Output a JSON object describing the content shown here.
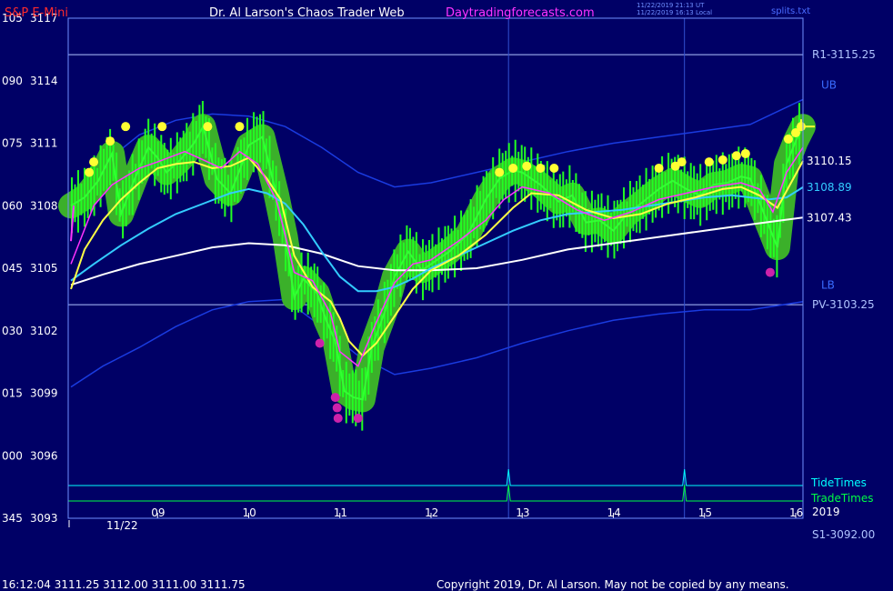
{
  "header": {
    "instrument": "S&P E-Mini",
    "site_title": "Dr. Al Larson's Chaos Trader Web",
    "site_url": "Daytradingforecasts.com",
    "stamp_ut": "11/22/2019 21:13 UT",
    "stamp_local": "11/22/2019 16:13 Local",
    "config_name": "splits.txt"
  },
  "footer": {
    "quote": "16:12:04  3111.25 3112.00 3111.00 3111.75",
    "copyright": "Copyright 2019, Dr. Al Larson. May not be copied by any means."
  },
  "chart_data": {
    "type": "line",
    "x_unit": "hour of day",
    "xlim": [
      8.02,
      16.08
    ],
    "ylim": [
      3093,
      3117
    ],
    "y_ticks": [
      {
        "value": 3117,
        "angle": "105"
      },
      {
        "value": 3114,
        "angle": "090"
      },
      {
        "value": 3111,
        "angle": "075"
      },
      {
        "value": 3108,
        "angle": "060"
      },
      {
        "value": 3105,
        "angle": "045"
      },
      {
        "value": 3102,
        "angle": "030"
      },
      {
        "value": 3099,
        "angle": "015"
      },
      {
        "value": 3096,
        "angle": "000"
      },
      {
        "value": 3093,
        "angle": "345"
      }
    ],
    "x_ticks": [
      "09",
      "10",
      "11",
      "12",
      "13",
      "14",
      "15",
      "16"
    ],
    "date_label": "11/22",
    "year_label": "2019",
    "pivot_levels": [
      {
        "label": "R1-3115.25",
        "value": 3115.25
      },
      {
        "label": "PV-3103.25",
        "value": 3103.25
      },
      {
        "label": "S1-3092.00",
        "value": 3092.0
      }
    ],
    "band_labels": {
      "upper": "UB",
      "lower": "LB"
    },
    "last_values": [
      {
        "label": "3110.15",
        "value": 3110.15,
        "color": "#ffffff"
      },
      {
        "label": "3108.89",
        "value": 3108.89,
        "color": "#33ccff"
      },
      {
        "label": "3107.43",
        "value": 3107.43,
        "color": "#ffffff"
      }
    ],
    "timing_lines": [
      {
        "name": "TideTimes",
        "color": "#00ffff",
        "spikes": [
          12.85,
          14.78
        ]
      },
      {
        "name": "TradeTimes",
        "color": "#00ff44",
        "spikes": [
          12.85,
          14.78
        ]
      }
    ],
    "vertical_markers": [
      12.85,
      14.78
    ],
    "series": [
      {
        "key": "price",
        "color": "#33ff33",
        "x": [
          8.05,
          8.2,
          8.35,
          8.5,
          8.6,
          8.75,
          8.9,
          9.0,
          9.1,
          9.25,
          9.4,
          9.5,
          9.65,
          9.8,
          9.9,
          10.0,
          10.15,
          10.3,
          10.4,
          10.5,
          10.6,
          10.75,
          10.85,
          10.95,
          11.05,
          11.15,
          11.25,
          11.35,
          11.5,
          11.6,
          11.75,
          11.9,
          12.0,
          12.2,
          12.4,
          12.6,
          12.75,
          12.9,
          13.0,
          13.2,
          13.4,
          13.55,
          13.7,
          13.85,
          14.0,
          14.15,
          14.3,
          14.5,
          14.65,
          14.8,
          14.95,
          15.1,
          15.25,
          15.4,
          15.5,
          15.6,
          15.7,
          15.8,
          15.9,
          16.0,
          16.08
        ],
        "values": [
          3108.0,
          3108.4,
          3109.2,
          3110.5,
          3107.6,
          3109.3,
          3110.8,
          3110.3,
          3109.6,
          3110.2,
          3111.0,
          3111.8,
          3109.3,
          3108.6,
          3109.7,
          3110.9,
          3111.3,
          3108.6,
          3106.5,
          3103.6,
          3104.5,
          3103.8,
          3102.5,
          3101.5,
          3099.1,
          3098.8,
          3098.7,
          3101.2,
          3103.0,
          3104.6,
          3105.8,
          3104.9,
          3105.2,
          3105.8,
          3106.6,
          3108.3,
          3109.3,
          3109.7,
          3109.6,
          3109.0,
          3108.2,
          3108.5,
          3107.2,
          3107.3,
          3106.8,
          3107.6,
          3108.1,
          3108.8,
          3109.2,
          3108.8,
          3108.5,
          3109.0,
          3109.1,
          3109.4,
          3109.3,
          3108.2,
          3107.1,
          3106.0,
          3110.0,
          3111.1,
          3111.8
        ]
      },
      {
        "key": "fast_avg",
        "color": "#ff33ff",
        "x": [
          8.05,
          8.3,
          8.5,
          8.8,
          9.0,
          9.3,
          9.5,
          9.7,
          9.9,
          10.1,
          10.3,
          10.4,
          10.5,
          10.7,
          10.9,
          11.0,
          11.2,
          11.4,
          11.6,
          11.8,
          12.0,
          12.3,
          12.6,
          12.8,
          13.0,
          13.3,
          13.6,
          13.9,
          14.2,
          14.5,
          14.8,
          15.1,
          15.4,
          15.6,
          15.75,
          15.9,
          16.08
        ],
        "values": [
          3105.2,
          3108.0,
          3109.0,
          3109.8,
          3110.1,
          3110.6,
          3110.2,
          3109.8,
          3110.6,
          3110.0,
          3108.3,
          3106.6,
          3104.8,
          3104.4,
          3102.8,
          3101.0,
          3100.3,
          3102.4,
          3104.3,
          3105.2,
          3105.4,
          3106.3,
          3107.3,
          3108.3,
          3108.9,
          3108.6,
          3107.8,
          3107.3,
          3107.7,
          3108.3,
          3108.6,
          3108.9,
          3109.1,
          3108.8,
          3107.7,
          3109.6,
          3110.8
        ]
      },
      {
        "key": "slow_avg",
        "color": "#ffff44",
        "x": [
          8.05,
          8.2,
          8.4,
          8.6,
          8.8,
          9.0,
          9.2,
          9.4,
          9.6,
          9.8,
          10.0,
          10.2,
          10.35,
          10.5,
          10.7,
          10.9,
          11.0,
          11.1,
          11.25,
          11.4,
          11.6,
          11.8,
          12.0,
          12.3,
          12.6,
          12.9,
          13.1,
          13.4,
          13.7,
          14.0,
          14.3,
          14.6,
          14.9,
          15.2,
          15.4,
          15.6,
          15.8,
          16.08
        ],
        "values": [
          3104.0,
          3105.9,
          3107.3,
          3108.3,
          3109.1,
          3109.8,
          3110.0,
          3110.1,
          3109.8,
          3109.9,
          3110.3,
          3109.3,
          3108.3,
          3105.6,
          3104.1,
          3103.4,
          3102.6,
          3101.5,
          3100.8,
          3101.4,
          3102.7,
          3104.0,
          3104.9,
          3105.6,
          3106.6,
          3107.9,
          3108.6,
          3108.5,
          3107.8,
          3107.4,
          3107.6,
          3108.1,
          3108.4,
          3108.8,
          3108.9,
          3108.5,
          3107.9,
          3110.15
        ]
      },
      {
        "key": "mid_avg",
        "color": "#33ccff",
        "x": [
          8.05,
          8.3,
          8.6,
          8.9,
          9.2,
          9.5,
          9.8,
          10.0,
          10.2,
          10.4,
          10.6,
          10.8,
          11.0,
          11.2,
          11.4,
          11.6,
          11.8,
          12.0,
          12.3,
          12.6,
          12.9,
          13.2,
          13.5,
          13.8,
          14.1,
          14.4,
          14.7,
          15.0,
          15.3,
          15.5,
          15.7,
          15.9,
          16.08
        ],
        "values": [
          3104.4,
          3105.2,
          3106.1,
          3106.9,
          3107.6,
          3108.1,
          3108.6,
          3108.8,
          3108.6,
          3108.1,
          3107.1,
          3105.8,
          3104.6,
          3103.9,
          3103.9,
          3104.1,
          3104.5,
          3105.0,
          3105.6,
          3106.2,
          3106.8,
          3107.3,
          3107.6,
          3107.7,
          3107.8,
          3108.0,
          3108.2,
          3108.4,
          3108.5,
          3108.4,
          3108.3,
          3108.4,
          3108.89
        ]
      },
      {
        "key": "long_avg",
        "color": "#ffffff",
        "x": [
          8.05,
          8.4,
          8.8,
          9.2,
          9.6,
          10.0,
          10.4,
          10.8,
          11.2,
          11.6,
          12.0,
          12.5,
          13.0,
          13.5,
          14.0,
          14.5,
          15.0,
          15.5,
          16.08
        ],
        "values": [
          3104.2,
          3104.7,
          3105.2,
          3105.6,
          3106.0,
          3106.2,
          3106.1,
          3105.7,
          3105.1,
          3104.9,
          3104.9,
          3105.0,
          3105.4,
          3105.9,
          3106.2,
          3106.5,
          3106.8,
          3107.1,
          3107.43
        ]
      },
      {
        "key": "upper_band",
        "color": "#1a3be0",
        "x": [
          8.05,
          8.4,
          8.8,
          9.2,
          9.6,
          10.0,
          10.4,
          10.8,
          11.2,
          11.6,
          12.0,
          12.5,
          13.0,
          13.5,
          14.0,
          14.5,
          15.0,
          15.5,
          16.08
        ],
        "values": [
          3108.3,
          3110.0,
          3111.4,
          3112.1,
          3112.4,
          3112.3,
          3111.8,
          3110.8,
          3109.6,
          3108.9,
          3109.1,
          3109.6,
          3110.1,
          3110.6,
          3111.0,
          3111.3,
          3111.6,
          3111.9,
          3113.1
        ]
      },
      {
        "key": "lower_band",
        "color": "#1a3be0",
        "x": [
          8.05,
          8.4,
          8.8,
          9.2,
          9.6,
          10.0,
          10.4,
          10.8,
          11.2,
          11.6,
          12.0,
          12.5,
          13.0,
          13.5,
          14.0,
          14.5,
          15.0,
          15.5,
          16.08
        ],
        "values": [
          3099.3,
          3100.3,
          3101.2,
          3102.2,
          3103.0,
          3103.4,
          3103.5,
          3102.2,
          3100.8,
          3099.9,
          3100.2,
          3100.7,
          3101.4,
          3102.0,
          3102.5,
          3102.8,
          3103.0,
          3103.0,
          3103.4
        ]
      }
    ],
    "top_dots": [
      {
        "x": 8.3,
        "value": 3110.1
      },
      {
        "x": 8.25,
        "value": 3109.6
      },
      {
        "x": 8.48,
        "value": 3111.1
      },
      {
        "x": 8.65,
        "value": 3111.8
      },
      {
        "x": 9.05,
        "value": 3111.8
      },
      {
        "x": 9.55,
        "value": 3111.8
      },
      {
        "x": 9.9,
        "value": 3111.8
      },
      {
        "x": 12.75,
        "value": 3109.6
      },
      {
        "x": 12.9,
        "value": 3109.8
      },
      {
        "x": 13.05,
        "value": 3109.9
      },
      {
        "x": 13.2,
        "value": 3109.8
      },
      {
        "x": 13.35,
        "value": 3109.8
      },
      {
        "x": 14.5,
        "value": 3109.8
      },
      {
        "x": 14.68,
        "value": 3109.9
      },
      {
        "x": 14.75,
        "value": 3110.1
      },
      {
        "x": 15.05,
        "value": 3110.1
      },
      {
        "x": 15.2,
        "value": 3110.2
      },
      {
        "x": 15.35,
        "value": 3110.4
      },
      {
        "x": 15.45,
        "value": 3110.5
      },
      {
        "x": 15.92,
        "value": 3111.2
      },
      {
        "x": 16.0,
        "value": 3111.5
      },
      {
        "x": 16.06,
        "value": 3111.8
      }
    ],
    "bottom_dots": [
      {
        "x": 10.78,
        "value": 3101.4
      },
      {
        "x": 10.95,
        "value": 3098.8
      },
      {
        "x": 10.97,
        "value": 3098.3
      },
      {
        "x": 10.98,
        "value": 3097.8
      },
      {
        "x": 11.2,
        "value": 3097.8
      },
      {
        "x": 15.72,
        "value": 3104.8
      }
    ]
  }
}
